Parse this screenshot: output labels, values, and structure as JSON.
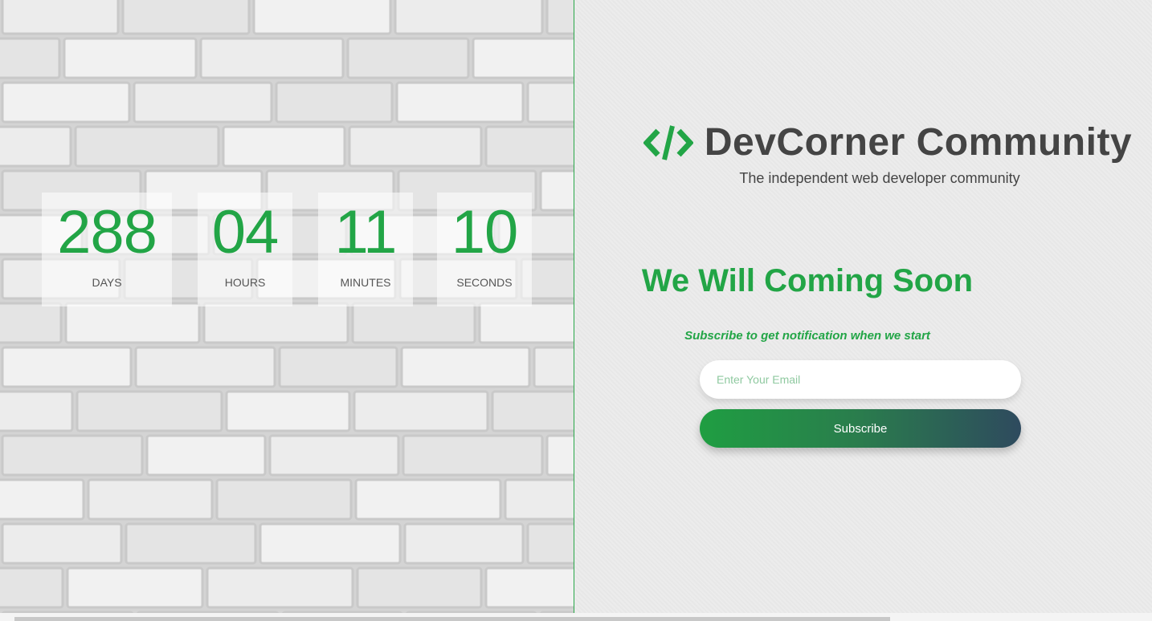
{
  "countdown": {
    "days": {
      "value": "288",
      "label": "DAYS"
    },
    "hours": {
      "value": "04",
      "label": "HOURS"
    },
    "minutes": {
      "value": "11",
      "label": "MINUTES"
    },
    "seconds": {
      "value": "10",
      "label": "SECONDS"
    }
  },
  "brand": {
    "icon": "code-brackets-icon",
    "title": "DevCorner Community",
    "tagline": "The independent web developer community"
  },
  "main": {
    "headline": "We Will Coming Soon",
    "subscribe_note": "Subscribe to get notification when we start"
  },
  "form": {
    "email_value": "",
    "email_placeholder": "Enter Your Email",
    "subscribe_label": "Subscribe"
  },
  "colors": {
    "accent": "#22a546",
    "text_dark": "#444444",
    "button_gradient_start": "#1f9e42",
    "button_gradient_end": "#2e4a5e"
  }
}
